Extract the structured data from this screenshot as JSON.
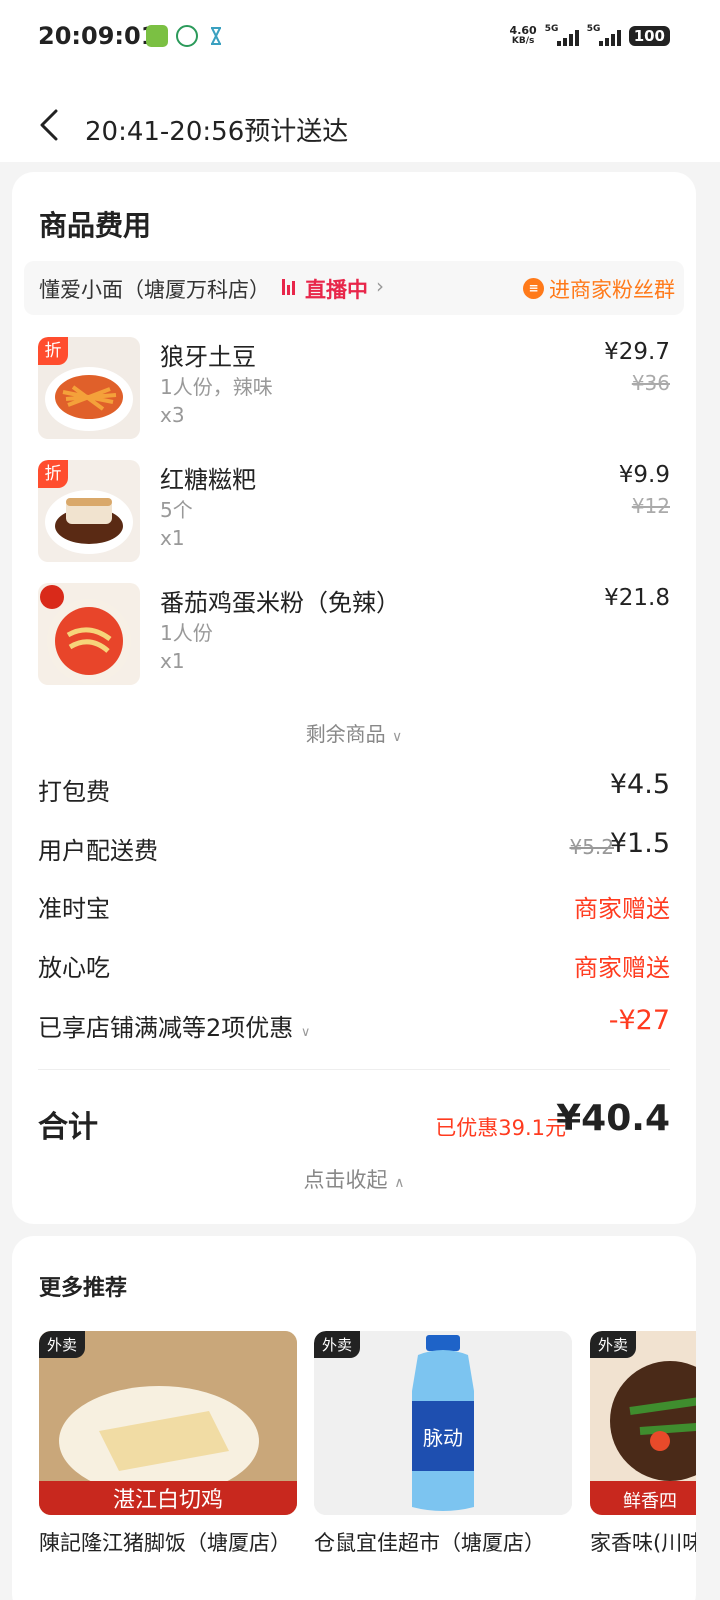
{
  "status_bar": {
    "time": "20:09:01",
    "net_speed": "4.60",
    "net_unit": "KB/s",
    "sim1": "5G",
    "sim2": "5G",
    "battery": "100"
  },
  "header": {
    "title": "20:41-20:56预计送达"
  },
  "fees_section": {
    "title": "商品费用",
    "store_name": "懂爱小面（塘厦万科店）",
    "live_label": "直播中",
    "fans_label": "进商家粉丝群",
    "items": [
      {
        "name": "狼牙土豆",
        "spec": "1人份，辣味",
        "qty": "x3",
        "price": "¥29.7",
        "orig_price": "¥36",
        "badge": "折"
      },
      {
        "name": "红糖糍粑",
        "spec": "5个",
        "qty": "x1",
        "price": "¥9.9",
        "orig_price": "¥12",
        "badge": "折"
      },
      {
        "name": "番茄鸡蛋米粉（免辣）",
        "spec": "1人份",
        "qty": "x1",
        "price": "¥21.8",
        "orig_price": "",
        "badge": ""
      }
    ],
    "remaining_label": "剩余商品",
    "fees": [
      {
        "label": "打包费",
        "value": "¥4.5",
        "orig": ""
      },
      {
        "label": "用户配送费",
        "value": "¥1.5",
        "orig": "¥5.2"
      },
      {
        "label": "准时宝",
        "value": "商家赠送",
        "orig": ""
      },
      {
        "label": "放心吃",
        "value": "商家赠送",
        "orig": ""
      },
      {
        "label": "已享店铺满减等2项优惠",
        "value": "-¥27",
        "orig": ""
      }
    ],
    "total_label": "合计",
    "saved_label": "已优惠39.1元",
    "total_amount": "¥40.4",
    "collapse_label": "点击收起"
  },
  "recommend": {
    "title": "更多推荐",
    "items": [
      {
        "tag": "外卖",
        "name": "陳記隆江猪脚饭（塘厦店）",
        "image_text": "湛江白切鸡"
      },
      {
        "tag": "外卖",
        "name": "仓鼠宜佳超市（塘厦店）",
        "image_text": "脉动"
      },
      {
        "tag": "外卖",
        "name": "家香味(川味",
        "image_text": "鲜香四"
      }
    ]
  },
  "colors": {
    "accent_red": "#ff3b1f",
    "live_pink": "#e8264a",
    "fans_orange": "#ff7a1a"
  }
}
